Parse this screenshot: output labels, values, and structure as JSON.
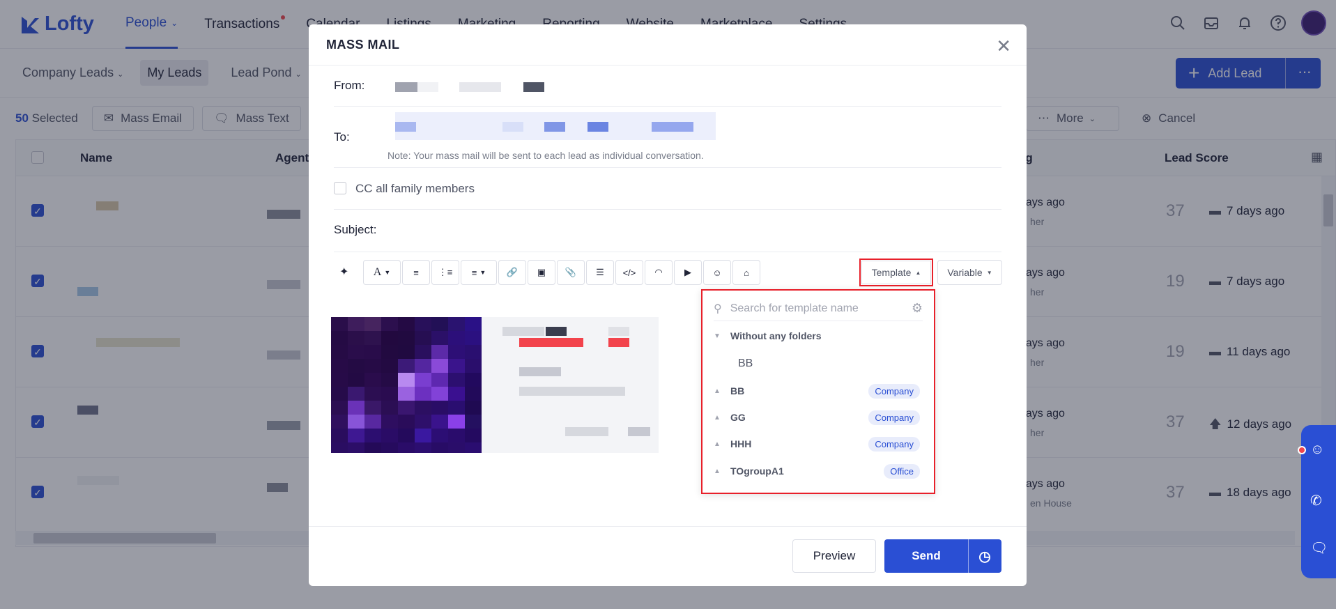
{
  "app": {
    "logo_text": "Lofty"
  },
  "nav": {
    "items": [
      {
        "label": "People"
      },
      {
        "label": "Transactions"
      },
      {
        "label": "Calendar"
      },
      {
        "label": "Listings"
      },
      {
        "label": "Marketing"
      },
      {
        "label": "Reporting"
      },
      {
        "label": "Website"
      },
      {
        "label": "Marketplace"
      },
      {
        "label": "Settings"
      }
    ]
  },
  "subnav": {
    "company_leads": "Company Leads",
    "my_leads": "My Leads",
    "lead_pond": "Lead Pond",
    "add_lead": "Add Lead"
  },
  "toolbar": {
    "selected_count": "50",
    "selected_label": "Selected",
    "mass_email": "Mass Email",
    "mass_text": "Mass Text",
    "more": "More",
    "cancel": "Cancel"
  },
  "table": {
    "headers": {
      "name": "Name",
      "agent": "Agent",
      "last": "ng",
      "lead_score": "Lead Score"
    },
    "rows": [
      {
        "days": "days ago",
        "sub": "her",
        "score": "37",
        "score_days": "7 days ago"
      },
      {
        "days": "days ago",
        "sub": "her",
        "score": "19",
        "score_days": "7 days ago"
      },
      {
        "days": "days ago",
        "sub": "her",
        "score": "19",
        "score_days": "11 days ago"
      },
      {
        "days": "days ago",
        "sub": "her",
        "score": "37",
        "score_days": "12 days ago"
      },
      {
        "days": "days ago",
        "sub": "en House",
        "score": "37",
        "score_days": "18 days ago"
      }
    ]
  },
  "modal": {
    "title": "MASS MAIL",
    "from_label": "From:",
    "to_label": "To:",
    "note": "Note: Your mass mail will be sent to each lead as individual conversation.",
    "cc_label": "CC all family members",
    "subject_label": "Subject:",
    "template_button": "Template",
    "variable_button": "Variable",
    "preview_button": "Preview",
    "send_button": "Send"
  },
  "template_dropdown": {
    "search_placeholder": "Search for template name",
    "folders": [
      {
        "name": "Without any folders",
        "expanded": true,
        "items": [
          "BB"
        ]
      },
      {
        "name": "BB",
        "badge": "Company"
      },
      {
        "name": "GG",
        "badge": "Company"
      },
      {
        "name": "HHH",
        "badge": "Company"
      },
      {
        "name": "TOgroupA1",
        "badge": "Office"
      }
    ]
  },
  "colors": {
    "accent": "#2a4fd4",
    "highlight": "#e8202a"
  }
}
